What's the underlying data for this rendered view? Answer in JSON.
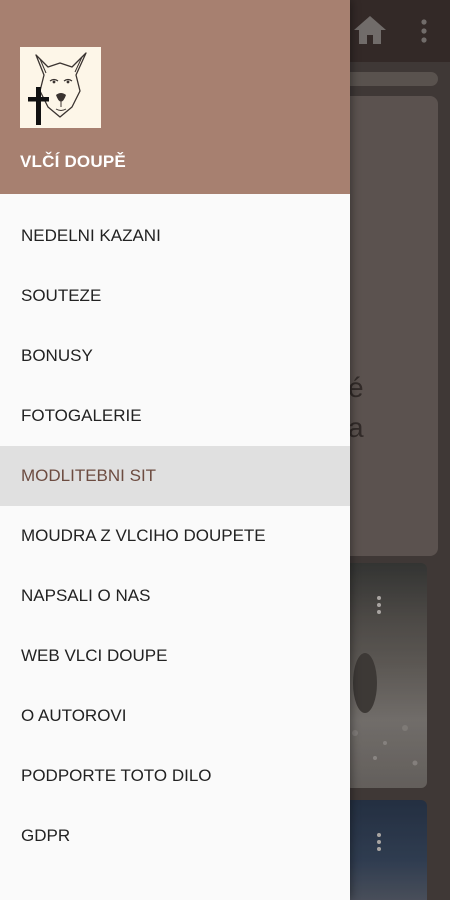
{
  "app": {
    "drawer_title": "VLČÍ DOUPĚ",
    "logo": "wolf-with-cross-logo"
  },
  "drawer_menu": {
    "items": [
      {
        "label": "NEDELNI KAZANI",
        "active": false
      },
      {
        "label": "SOUTEZE",
        "active": false
      },
      {
        "label": "BONUSY",
        "active": false
      },
      {
        "label": "FOTOGALERIE",
        "active": false
      },
      {
        "label": "MODLITEBNI SIT",
        "active": true
      },
      {
        "label": "MOUDRA Z VLCIHO DOUPETE",
        "active": false
      },
      {
        "label": "NAPSALI O NAS",
        "active": false
      },
      {
        "label": "WEB VLCI DOUPE",
        "active": false
      },
      {
        "label": "O AUTOROVI",
        "active": false
      },
      {
        "label": "PODPORTE TOTO DILO",
        "active": false
      },
      {
        "label": "GDPR",
        "active": false
      }
    ]
  },
  "background": {
    "toolbar_icons": [
      "home-icon",
      "more-vert-icon"
    ],
    "card_text_fragments": [
      "é",
      "a"
    ]
  },
  "colors": {
    "header": "#a78070",
    "active_item_bg": "#e0e0e0",
    "active_item_text": "#6d4c41",
    "toolbar": "#3f3330"
  }
}
